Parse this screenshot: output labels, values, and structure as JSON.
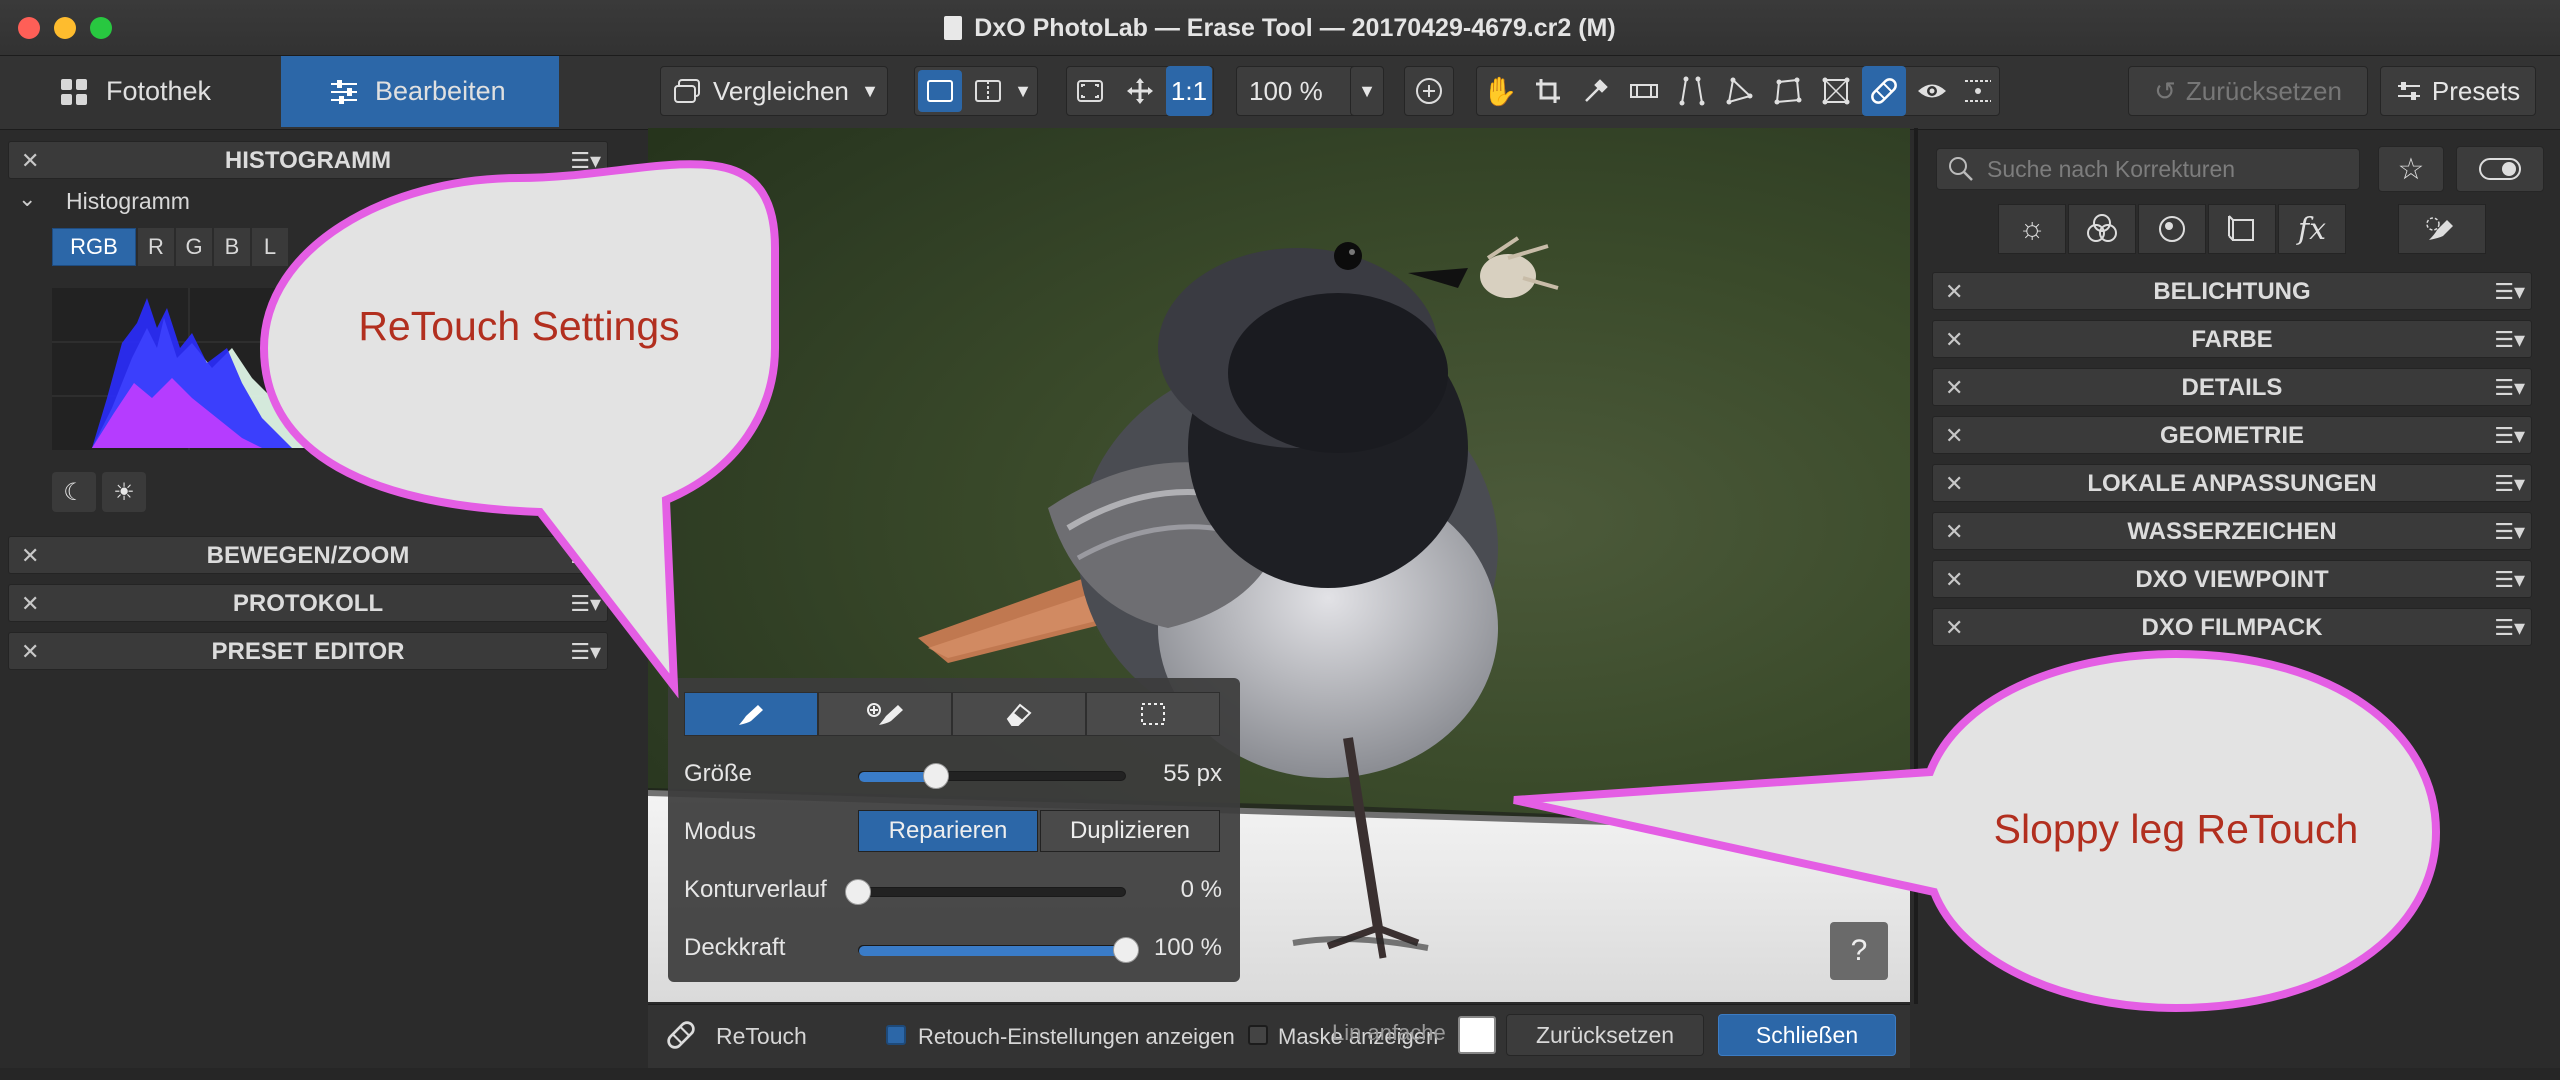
{
  "window": {
    "title": "DxO PhotoLab — Erase Tool — 20170429-4679.cr2 (M)"
  },
  "tabs": {
    "library": "Fotothek",
    "edit": "Bearbeiten"
  },
  "toolbar": {
    "compare": "Vergleichen",
    "one_to_one": "1:1",
    "zoom": "100 %",
    "reset": "Zurücksetzen",
    "presets": "Presets"
  },
  "left_panel": {
    "histogram_header": "HISTOGRAMM",
    "histogram_sub": "Histogramm",
    "channels": [
      "RGB",
      "R",
      "G",
      "B",
      "L"
    ],
    "move_zoom": "BEWEGEN/ZOOM",
    "history": "PROTOKOLL",
    "preset_editor": "PRESET EDITOR"
  },
  "right_panel": {
    "search_placeholder": "Suche nach Korrekturen",
    "fx_label": "fx",
    "sections": [
      "BELICHTUNG",
      "FARBE",
      "DETAILS",
      "GEOMETRIE",
      "LOKALE ANPASSUNGEN",
      "WASSERZEICHEN",
      "DXO VIEWPOINT",
      "DXO FILMPACK"
    ]
  },
  "retouch_palette": {
    "size_label": "Größe",
    "size_value": "55 px",
    "size_fraction": 0.29,
    "mode_label": "Modus",
    "mode_repair": "Reparieren",
    "mode_duplicate": "Duplizieren",
    "feather_label": "Konturverlauf",
    "feather_value": "0 %",
    "feather_fraction": 0.0,
    "opacity_label": "Deckkraft",
    "opacity_value": "100 %",
    "opacity_fraction": 1.0,
    "help": "?"
  },
  "bottom_bar": {
    "tool_name": "ReTouch",
    "show_settings": "Retouch-Einstellungen anzeigen",
    "show_mask": "Maske anzeigen",
    "overlay_text": "Lin anfache",
    "reset": "Zurücksetzen",
    "close": "Schließen"
  },
  "annotations": {
    "callout_settings": "ReTouch Settings",
    "callout_leg": "Sloppy leg ReTouch"
  },
  "colors": {
    "accent": "#2c67a8",
    "callout_border": "#e45ee4",
    "callout_text": "#b22f1f"
  }
}
